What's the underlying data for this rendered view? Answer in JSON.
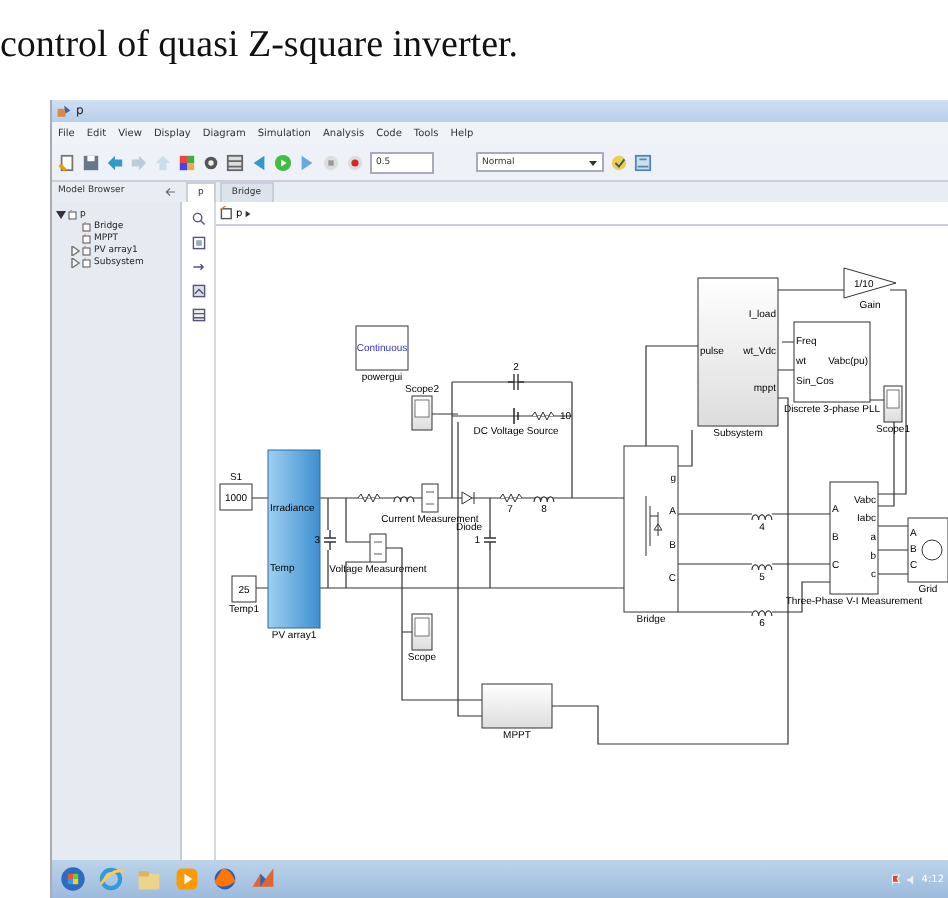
{
  "caption": "control of quasi Z-square inverter.",
  "window": {
    "title": "p"
  },
  "menu": [
    "File",
    "Edit",
    "View",
    "Display",
    "Diagram",
    "Simulation",
    "Analysis",
    "Code",
    "Tools",
    "Help"
  ],
  "toolbar": {
    "stop_time": "0.5",
    "mode": "Normal"
  },
  "model_browser": {
    "title": "Model Browser",
    "tree": [
      {
        "label": "p",
        "has_children": true,
        "expanded": true,
        "children": [
          {
            "label": "Bridge",
            "has_children": false
          },
          {
            "label": "MPPT",
            "has_children": false
          },
          {
            "label": "PV array1",
            "has_children": true,
            "expanded": false
          },
          {
            "label": "Subsystem",
            "has_children": true,
            "expanded": false
          }
        ]
      }
    ]
  },
  "tabs": [
    {
      "label": "p",
      "selected": true
    },
    {
      "label": "Bridge",
      "selected": false
    }
  ],
  "breadcrumb": "p",
  "diagram": {
    "blocks": [
      {
        "kind": "powergui",
        "text": "Continuous",
        "label": "powergui"
      },
      {
        "kind": "scope",
        "label": "Scope2"
      },
      {
        "kind": "capacitor",
        "label": "2"
      },
      {
        "kind": "dc_source",
        "label": "DC Voltage Source"
      },
      {
        "kind": "resistor",
        "label": "10"
      },
      {
        "kind": "constant",
        "text": "1000",
        "label": "S1"
      },
      {
        "kind": "constant",
        "text": "25",
        "label": "Temp1"
      },
      {
        "kind": "pv_array",
        "label": "PV array1",
        "inputs": [
          "Irradiance",
          "Temp"
        ]
      },
      {
        "kind": "resistor"
      },
      {
        "kind": "inductor"
      },
      {
        "kind": "capacitor_v",
        "label": "3"
      },
      {
        "kind": "measurement",
        "label": "Current Measurement"
      },
      {
        "kind": "diode",
        "label": "Diode"
      },
      {
        "kind": "capacitor_v",
        "label": "1"
      },
      {
        "kind": "resistor",
        "label": "7"
      },
      {
        "kind": "inductor",
        "label": "8"
      },
      {
        "kind": "measurement",
        "label": "Voltage Measurement"
      },
      {
        "kind": "subsystem",
        "label": "Subsystem",
        "inputs": [
          "pulse"
        ],
        "outputs": [
          "I_load",
          "wt_Vdc",
          "mppt"
        ]
      },
      {
        "kind": "gain",
        "text": "1/10",
        "label": "Gain"
      },
      {
        "kind": "block",
        "label": "Discrete 3-phase PLL",
        "inputs": [
          "Freq",
          "wt",
          "Sin_Cos"
        ],
        "outputs": [
          "Vabc(pu)"
        ]
      },
      {
        "kind": "scope",
        "label": "Scope1"
      },
      {
        "kind": "bridge",
        "label": "Bridge",
        "outputs": [
          "g",
          "A",
          "B",
          "C"
        ]
      },
      {
        "kind": "inductor",
        "label": "4"
      },
      {
        "kind": "inductor",
        "label": "5"
      },
      {
        "kind": "inductor",
        "label": "6"
      },
      {
        "kind": "block",
        "label": "Three-Phase V-I Measurement",
        "inputs": [
          "A",
          "B",
          "C"
        ],
        "outputs": [
          "Vabc",
          "Iabc",
          "a",
          "b",
          "c"
        ]
      },
      {
        "kind": "source",
        "label": "Grid",
        "inputs": [
          "A",
          "B",
          "C"
        ]
      },
      {
        "kind": "scope",
        "label": "Scope"
      },
      {
        "kind": "subsystem",
        "label": "MPPT"
      }
    ]
  },
  "taskbar": {
    "time": "4:12"
  }
}
